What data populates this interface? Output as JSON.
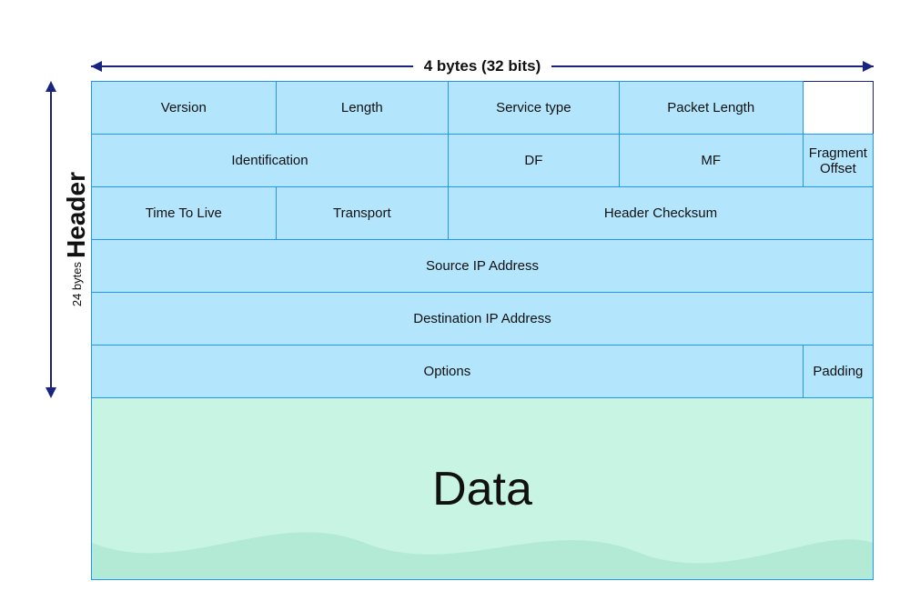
{
  "top_arrow": {
    "label": "4 bytes (32 bits)"
  },
  "left_label": {
    "big": "Header",
    "small": "24 bytes"
  },
  "rows": [
    {
      "cells": [
        {
          "text": "Version",
          "colspan": 1,
          "rowspan": 1
        },
        {
          "text": "Length",
          "colspan": 1,
          "rowspan": 1
        },
        {
          "text": "Service type",
          "colspan": 1,
          "rowspan": 1
        },
        {
          "text": "Packet Length",
          "colspan": 1,
          "rowspan": 1
        }
      ]
    },
    {
      "cells": [
        {
          "text": "Identification",
          "colspan": 2,
          "rowspan": 1
        },
        {
          "text": "DF",
          "colspan": 1,
          "rowspan": 1
        },
        {
          "text": "MF",
          "colspan": 1,
          "rowspan": 1
        },
        {
          "text": "Fragment Offset",
          "colspan": 1,
          "rowspan": 1
        }
      ]
    },
    {
      "cells": [
        {
          "text": "Time To Live",
          "colspan": 1,
          "rowspan": 1
        },
        {
          "text": "Transport",
          "colspan": 1,
          "rowspan": 1
        },
        {
          "text": "Header Checksum",
          "colspan": 2,
          "rowspan": 1
        }
      ]
    },
    {
      "cells": [
        {
          "text": "Source IP Address",
          "colspan": 4,
          "rowspan": 1
        }
      ]
    },
    {
      "cells": [
        {
          "text": "Destination IP Address",
          "colspan": 4,
          "rowspan": 1
        }
      ]
    },
    {
      "cells": [
        {
          "text": "Options",
          "colspan": 3,
          "rowspan": 1
        },
        {
          "text": "Padding",
          "colspan": 1,
          "rowspan": 1
        }
      ]
    }
  ],
  "data_label": "Data"
}
